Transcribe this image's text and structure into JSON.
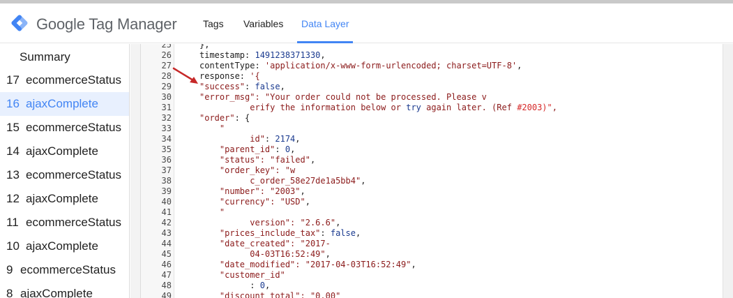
{
  "app": {
    "title": "Google Tag Manager"
  },
  "nav": {
    "tabs": [
      "Tags",
      "Variables",
      "Data Layer"
    ],
    "active": "Data Layer"
  },
  "sidebar": {
    "summary": "Summary",
    "items": [
      {
        "num": "17",
        "label": "ecommerceStatus"
      },
      {
        "num": "16",
        "label": "ajaxComplete",
        "active": true
      },
      {
        "num": "15",
        "label": "ecommerceStatus"
      },
      {
        "num": "14",
        "label": "ajaxComplete"
      },
      {
        "num": "13",
        "label": "ecommerceStatus"
      },
      {
        "num": "12",
        "label": "ajaxComplete"
      },
      {
        "num": "11",
        "label": "ecommerceStatus"
      },
      {
        "num": "10",
        "label": "ajaxComplete"
      },
      {
        "num": "9",
        "label": "ecommerceStatus"
      },
      {
        "num": "8",
        "label": "ajaxComplete"
      }
    ]
  },
  "code": {
    "lines": [
      {
        "n": "25",
        "t": [
          [
            "k",
            "},"
          ]
        ]
      },
      {
        "n": "26",
        "t": [
          [
            "k",
            "timestamp: "
          ],
          [
            "n",
            "1491238371330"
          ],
          [
            "k",
            ","
          ]
        ]
      },
      {
        "n": "27",
        "t": [
          [
            "k",
            "contentType: "
          ],
          [
            "s",
            "'application/x-www-form-urlencoded; charset=UTF-8'"
          ],
          [
            "k",
            ","
          ]
        ]
      },
      {
        "n": "28",
        "t": [
          [
            "k",
            "response: "
          ],
          [
            "s",
            "'{"
          ]
        ]
      },
      {
        "n": "29",
        "t": [
          [
            "s",
            "\"success\""
          ],
          [
            "k",
            ": "
          ],
          [
            "n",
            "false"
          ],
          [
            "k",
            ","
          ]
        ]
      },
      {
        "n": "30",
        "t": [
          [
            "s",
            "\"error_msg\": \"Your order could not be processed. Please v"
          ]
        ]
      },
      {
        "n": "31",
        "t": [
          [
            "s",
            "          erify the information below or "
          ],
          [
            "n",
            "try"
          ],
          [
            "s",
            " again later. (Ref "
          ],
          [
            "r",
            "#2003)\""
          ],
          [
            "s",
            ","
          ]
        ]
      },
      {
        "n": "32",
        "t": [
          [
            "s",
            "\"order\""
          ],
          [
            "k",
            ": {"
          ]
        ]
      },
      {
        "n": "33",
        "t": [
          [
            "s",
            "    \""
          ]
        ]
      },
      {
        "n": "34",
        "t": [
          [
            "s",
            "          id\""
          ],
          [
            "k",
            ": "
          ],
          [
            "n",
            "2174"
          ],
          [
            "k",
            ","
          ]
        ]
      },
      {
        "n": "35",
        "t": [
          [
            "s",
            "    \"parent_id\""
          ],
          [
            "k",
            ": "
          ],
          [
            "n",
            "0"
          ],
          [
            "k",
            ","
          ]
        ]
      },
      {
        "n": "36",
        "t": [
          [
            "s",
            "    \"status\": \"failed\""
          ],
          [
            "k",
            ","
          ]
        ]
      },
      {
        "n": "37",
        "t": [
          [
            "s",
            "    \"order_key\": \"w"
          ]
        ]
      },
      {
        "n": "38",
        "t": [
          [
            "s",
            "          c_order_58e27de1a5bb4\""
          ],
          [
            "k",
            ","
          ]
        ]
      },
      {
        "n": "39",
        "t": [
          [
            "s",
            "    \"number\": \"2003\""
          ],
          [
            "k",
            ","
          ]
        ]
      },
      {
        "n": "40",
        "t": [
          [
            "s",
            "    \"currency\": \"USD\""
          ],
          [
            "k",
            ","
          ]
        ]
      },
      {
        "n": "41",
        "t": [
          [
            "s",
            "    \""
          ]
        ]
      },
      {
        "n": "42",
        "t": [
          [
            "s",
            "          version\": \"2.6.6\""
          ],
          [
            "k",
            ","
          ]
        ]
      },
      {
        "n": "43",
        "t": [
          [
            "s",
            "    \"prices_include_tax\""
          ],
          [
            "k",
            ": "
          ],
          [
            "n",
            "false"
          ],
          [
            "k",
            ","
          ]
        ]
      },
      {
        "n": "44",
        "t": [
          [
            "s",
            "    \"date_created\": \"2017-"
          ]
        ]
      },
      {
        "n": "45",
        "t": [
          [
            "s",
            "          04-03T16:52:49\""
          ],
          [
            "k",
            ","
          ]
        ]
      },
      {
        "n": "46",
        "t": [
          [
            "s",
            "    \"date_modified\": \"2017-04-03T16:52:49\""
          ],
          [
            "k",
            ","
          ]
        ]
      },
      {
        "n": "47",
        "t": [
          [
            "s",
            "    \"customer_id\""
          ]
        ]
      },
      {
        "n": "48",
        "t": [
          [
            "k",
            "          : "
          ],
          [
            "n",
            "0"
          ],
          [
            "k",
            ","
          ]
        ]
      },
      {
        "n": "49",
        "t": [
          [
            "s",
            "    \"discount_total\": \"0.00\""
          ]
        ]
      }
    ]
  },
  "colors": {
    "accent": "#4285f4",
    "annotation_arrow": "#c62828"
  },
  "icons": {
    "logo": "gtm-diamond-logo",
    "annotation": "red-arrow-annotation"
  }
}
